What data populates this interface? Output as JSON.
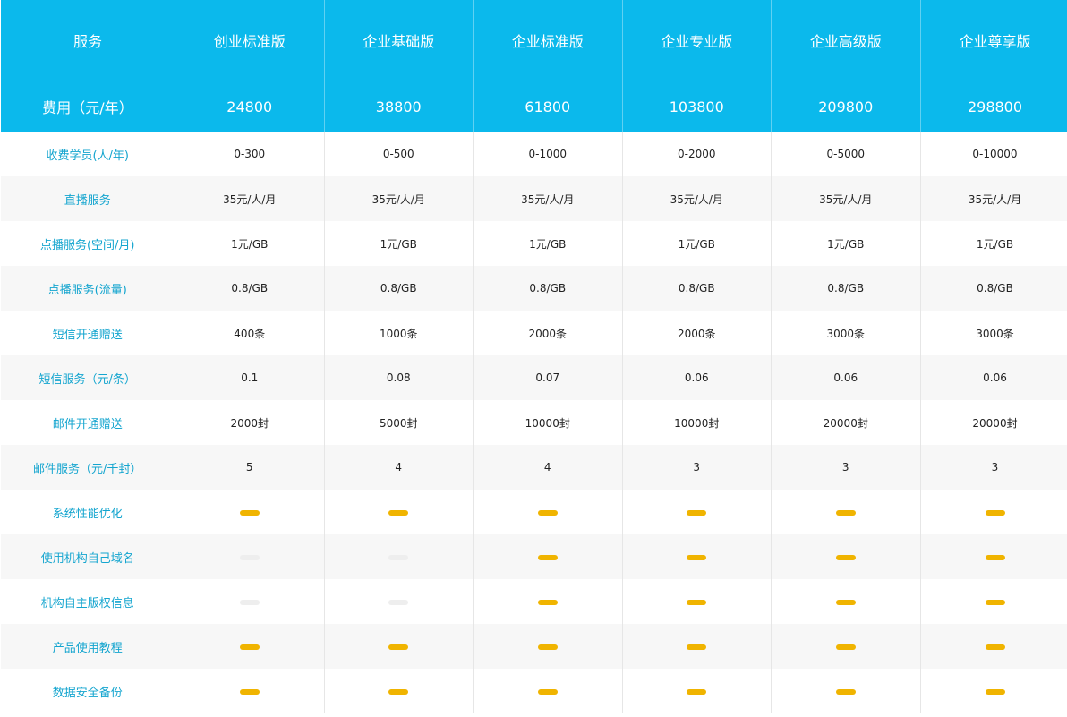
{
  "colors": {
    "header_bg": "#0bb9ec",
    "header_text": "#ffffff",
    "row_label": "#14a5cf",
    "check_on": "#f0b400",
    "check_off": "#eeeeee"
  },
  "header": {
    "service_label": "服务",
    "plans": [
      "创业标准版",
      "企业基础版",
      "企业标准版",
      "企业专业版",
      "企业高级版",
      "企业尊享版"
    ]
  },
  "price_row": {
    "label": "费用（元/年）",
    "values": [
      "24800",
      "38800",
      "61800",
      "103800",
      "209800",
      "298800"
    ]
  },
  "rows": [
    {
      "label": "收费学员(人/年)",
      "values": [
        "0-300",
        "0-500",
        "0-1000",
        "0-2000",
        "0-5000",
        "0-10000"
      ]
    },
    {
      "label": "直播服务",
      "values": [
        "35元/人/月",
        "35元/人/月",
        "35元/人/月",
        "35元/人/月",
        "35元/人/月",
        "35元/人/月"
      ]
    },
    {
      "label": "点播服务(空间/月)",
      "values": [
        "1元/GB",
        "1元/GB",
        "1元/GB",
        "1元/GB",
        "1元/GB",
        "1元/GB"
      ]
    },
    {
      "label": "点播服务(流量)",
      "values": [
        "0.8/GB",
        "0.8/GB",
        "0.8/GB",
        "0.8/GB",
        "0.8/GB",
        "0.8/GB"
      ]
    },
    {
      "label": "短信开通赠送",
      "values": [
        "400条",
        "1000条",
        "2000条",
        "2000条",
        "3000条",
        "3000条"
      ]
    },
    {
      "label": "短信服务（元/条）",
      "values": [
        "0.1",
        "0.08",
        "0.07",
        "0.06",
        "0.06",
        "0.06"
      ]
    },
    {
      "label": "邮件开通赠送",
      "values": [
        "2000封",
        "5000封",
        "10000封",
        "10000封",
        "20000封",
        "20000封"
      ]
    },
    {
      "label": "邮件服务（元/千封）",
      "values": [
        "5",
        "4",
        "4",
        "3",
        "3",
        "3"
      ]
    }
  ],
  "feature_rows": [
    {
      "label": "系统性能优化",
      "included": [
        true,
        true,
        true,
        true,
        true,
        true
      ]
    },
    {
      "label": "使用机构自己域名",
      "included": [
        false,
        false,
        true,
        true,
        true,
        true
      ]
    },
    {
      "label": "机构自主版权信息",
      "included": [
        false,
        false,
        true,
        true,
        true,
        true
      ]
    },
    {
      "label": "产品使用教程",
      "included": [
        true,
        true,
        true,
        true,
        true,
        true
      ]
    },
    {
      "label": "数据安全备份",
      "included": [
        true,
        true,
        true,
        true,
        true,
        true
      ]
    }
  ],
  "icons": {
    "included": "dash-included-icon",
    "not_included": "dash-excluded-icon"
  }
}
